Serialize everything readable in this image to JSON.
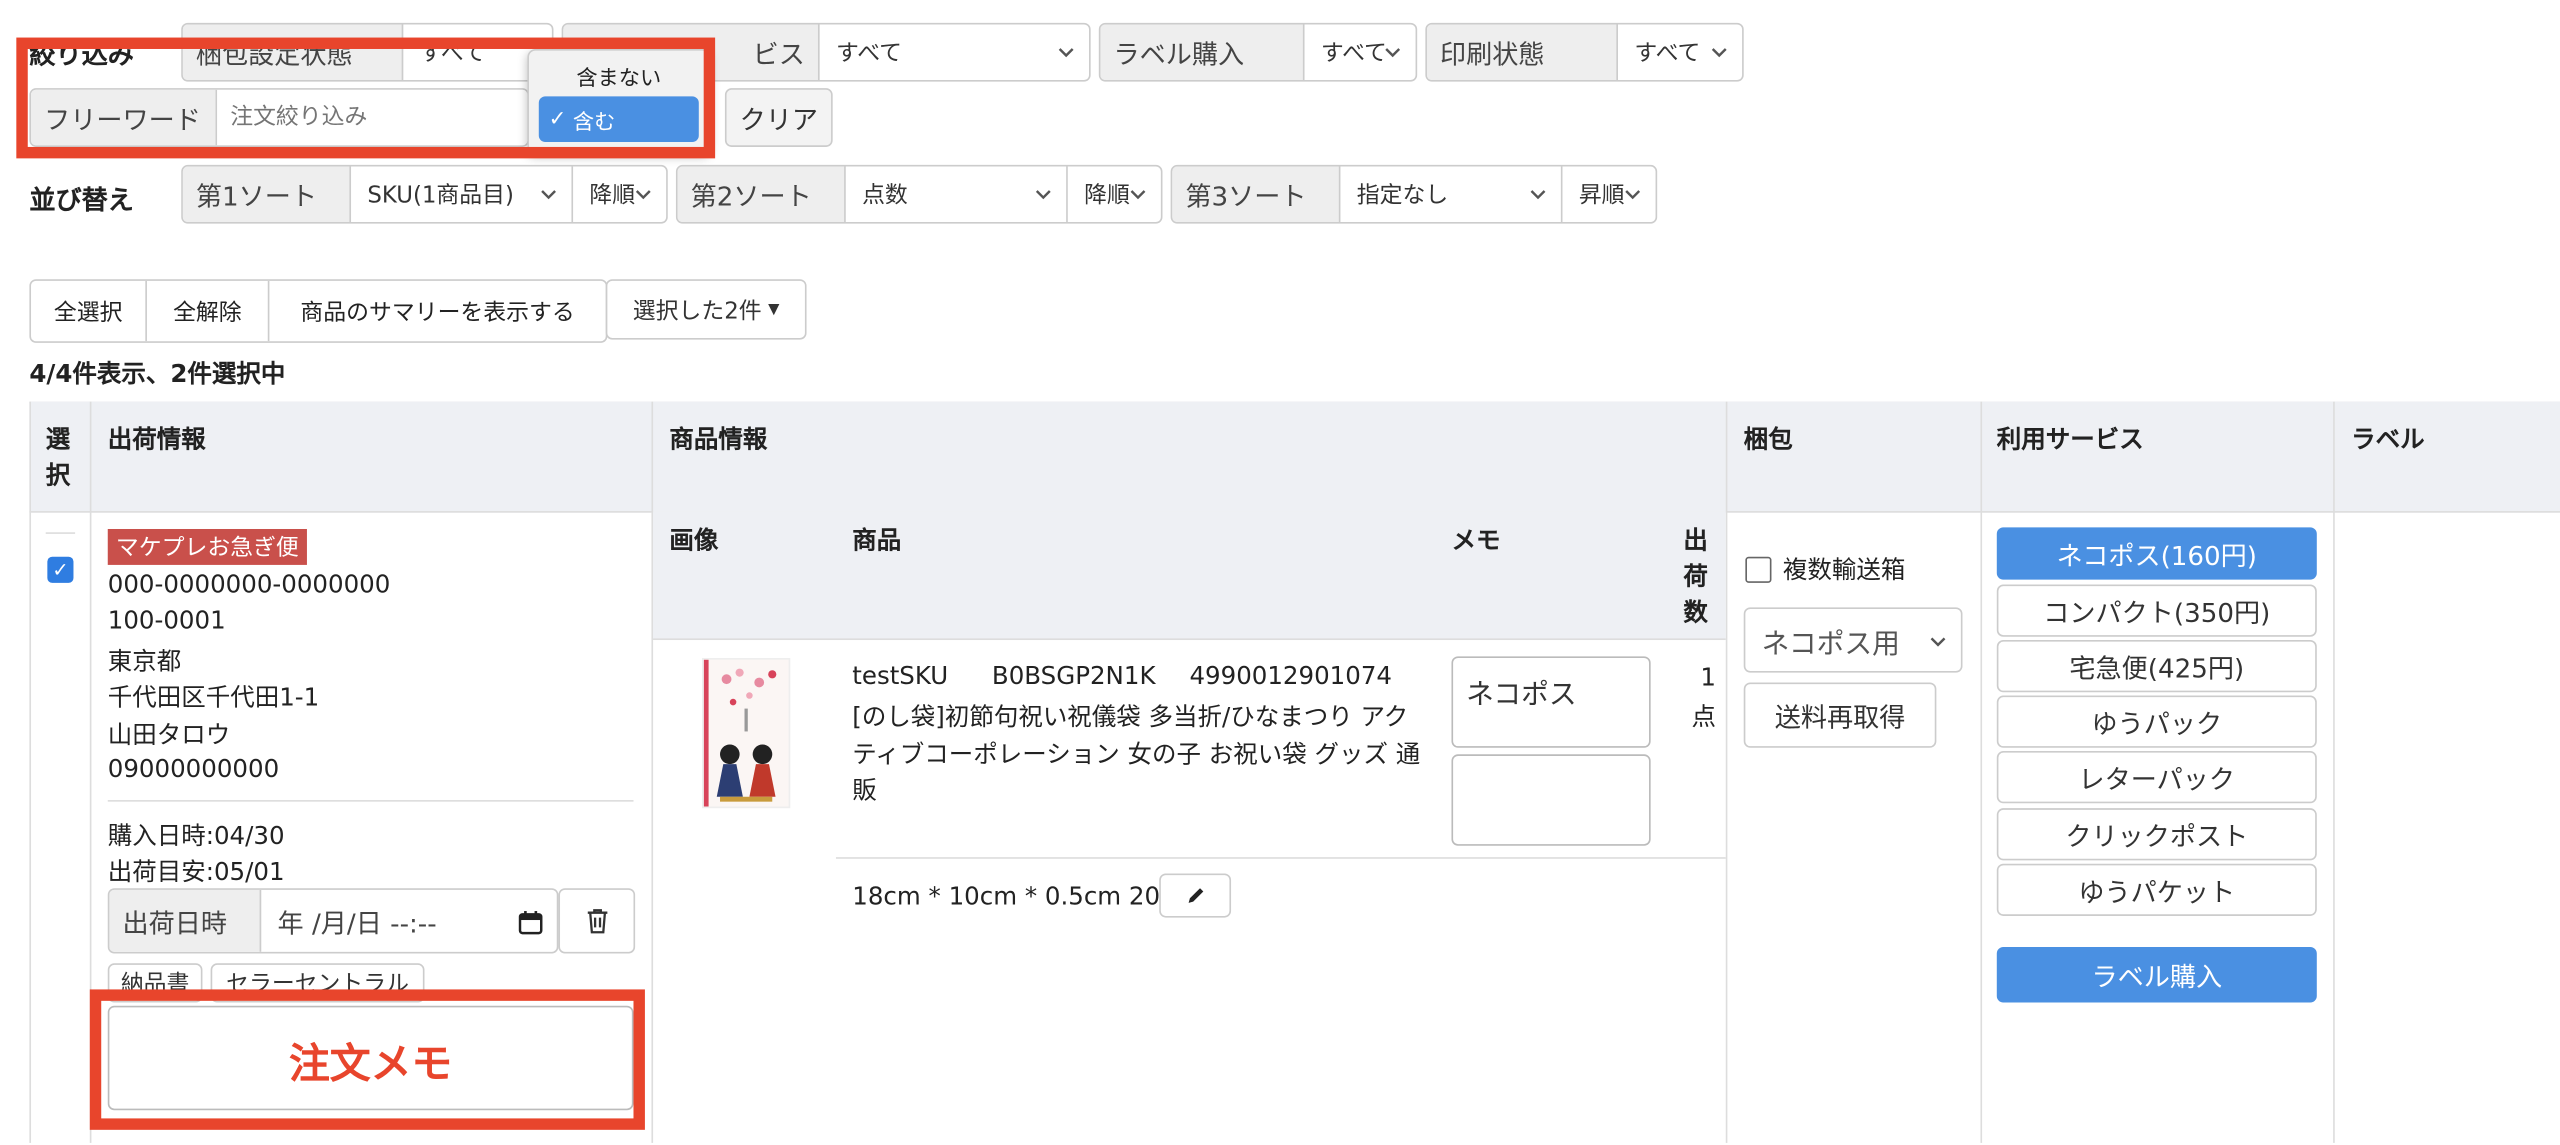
{
  "filter": {
    "section_label": "絞り込み",
    "packing_label": "梱包設定状態",
    "packing_value": "すべて",
    "service_label": "ビス",
    "service_value": "すべて",
    "label_purchase_label": "ラベル購入",
    "label_purchase_value": "すべて",
    "print_label": "印刷状態",
    "print_value": "すべて",
    "freeword_label": "フリーワード",
    "freeword_placeholder": "注文絞り込み",
    "clear_label": "クリア",
    "dropdown_options": [
      "含まない",
      "含む"
    ],
    "dropdown_selected": "含む"
  },
  "sort": {
    "section_label": "並び替え",
    "sort1_label": "第1ソート",
    "sort1_value": "SKU(1商品目)",
    "sort1_order": "降順",
    "sort2_label": "第2ソート",
    "sort2_value": "点数",
    "sort2_order": "降順",
    "sort3_label": "第3ソート",
    "sort3_value": "指定なし",
    "sort3_order": "昇順"
  },
  "actions": {
    "select_all": "全選択",
    "deselect_all": "全解除",
    "show_summary": "商品のサマリーを表示する",
    "selected_menu": "選択した2件"
  },
  "status_text": "4/4件表示、2件選択中",
  "table": {
    "headers": {
      "select": "選択",
      "shipping": "出荷情報",
      "product": "商品情報",
      "packing": "梱包",
      "service": "利用サービス",
      "label": "ラベル"
    },
    "sub_headers": {
      "image": "画像",
      "item": "商品",
      "memo": "メモ",
      "qty": "出荷数"
    }
  },
  "order": {
    "badge": "マケプレお急ぎ便",
    "order_id": "000-0000000-0000000",
    "postal": "100-0001",
    "prefecture": "東京都",
    "address": "千代田区千代田1-1",
    "name": "山田タロウ",
    "phone": "09000000000",
    "purchase_date": "購入日時:04/30",
    "ship_target": "出荷目安:05/01",
    "ship_date_label": "出荷日時",
    "ship_date_placeholder": "年 /月/日 --:--",
    "btn_invoice": "納品書",
    "btn_seller_central": "セラーセントラル",
    "memo_note": "注文メモ",
    "checked": true
  },
  "item": {
    "sku": "testSKU",
    "asin": "B0BSGP2N1K",
    "jan": "4990012901074",
    "title": "[のし袋]初節句祝い祝儀袋 多当折/ひなまつり アクティブコーポレーション 女の子 お祝い袋 グッズ 通販",
    "memo1": "ネコポス",
    "memo2": "",
    "qty": "1",
    "qty_unit": "点",
    "dimensions": "18cm * 10cm * 0.5cm 20g"
  },
  "packing": {
    "multi_box_label": "複数輸送箱",
    "box_select": "ネコポス用",
    "refetch_label": "送料再取得"
  },
  "services": [
    "ネコポス(160円)",
    "コンパクト(350円)",
    "宅急便(425円)",
    "ゆうパック",
    "レターパック",
    "クリックポスト",
    "ゆうパケット"
  ],
  "buy_label": "ラベル購入",
  "colors": {
    "accent": "#4a90e2",
    "highlight": "#e8452c",
    "badge": "#c9504b"
  }
}
